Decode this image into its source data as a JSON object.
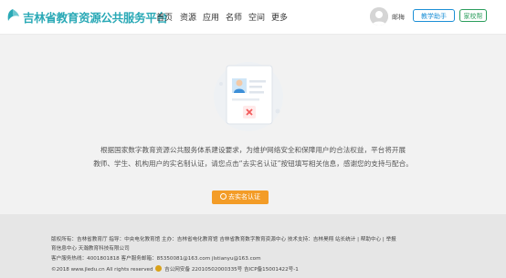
{
  "header": {
    "logo_text": "吉林省教育资源公共服务平台",
    "nav": [
      "首页",
      "资源",
      "应用",
      "名师",
      "空间",
      "更多"
    ],
    "username": "邮梅",
    "assistant_button": "教学助手",
    "school_button": "家校帮"
  },
  "main": {
    "notice_line1": "根据国家数字教育资源公共服务体系建设要求，为维护网络安全和保障用户的合法权益，平台将开展",
    "notice_line2": "教师、学生、机构用户的实名制认证，请您点击“去实名认证”按钮填写相关信息，感谢您的支持与配合。",
    "verify_button": "去实名认证"
  },
  "footer": {
    "line1": "版权所有：吉林省教育厅  指导：中央电化教育馆  主办：吉林省电化教育馆  吉林省教育数字教育资源中心  技术支持：吉林昊翔    站长统计  |  帮助中心  |  举报",
    "line2": "育信息中心 天瀚教育科技有限公司",
    "line3": "客户服务热线：4001801818   客户服务邮箱：85350081@163.com   jlstianyu@163.com",
    "line4_a": "©2018 www.jledu.cn All rights reserved",
    "line4_b": "吉公网安备 22010502000335号   吉ICP备15001422号-1"
  },
  "colors": {
    "brand": "#2aa9b6",
    "link_blue": "#1b8fd6",
    "green": "#2a9d5c",
    "orange": "#f39c27"
  }
}
